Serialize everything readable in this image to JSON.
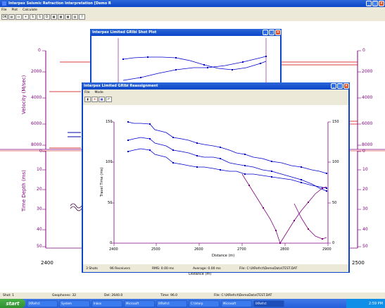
{
  "app": {
    "title": "Interpex Seismic Refraction Interpretation [Demo R",
    "menu": [
      "File",
      "Plot",
      "Calculate"
    ],
    "toolbar": [
      "OK",
      "",
      "",
      "",
      "S",
      "S",
      "D",
      "",
      "",
      "",
      "",
      "?"
    ]
  },
  "main_plot": {
    "left_axis_label": "Velocity (M/sec)",
    "left_axis_ticks": [
      "0",
      "2000",
      "4000",
      "6000",
      "8000"
    ],
    "right_axis_ticks": [
      "0",
      "2000",
      "4000",
      "6000",
      "8000"
    ],
    "depth_axis_label": "Time Depth (ms)",
    "depth_ticks": [
      "0",
      "10",
      "20",
      "30",
      "40",
      "50"
    ],
    "depth_right_ticks": [
      "0",
      "10",
      "20",
      "30",
      "40",
      "50"
    ],
    "bottom_left_label": "2400",
    "bottom_right_label": "2500",
    "bottom_axis_label": "Distance (m)"
  },
  "gribi_window": {
    "title": "Interpex Limited GRIbi Shot Plot"
  },
  "reassign_window": {
    "title": "Interpex Limited GRIbi Reassignment",
    "menu": [
      "File",
      "Mode"
    ],
    "toolbar": [
      "",
      "",
      "",
      ""
    ],
    "y_label": "Travel Time (ms)",
    "x_label": "Distance (m)",
    "y_ticks": [
      "150",
      "100",
      "50",
      "0"
    ],
    "y_right_ticks": [
      "150",
      "100",
      "50",
      "0"
    ],
    "x_ticks": [
      "2400",
      "2500",
      "2600",
      "2700",
      "2800",
      "2900"
    ],
    "status": [
      "3 Shots",
      "96 Receivers",
      "RMS: 0.00 ms",
      "Average: 0.00 ms",
      "File: C:\\IXRefrct\\DemoData\\TEST.DAT"
    ]
  },
  "status_bar": [
    "Shot: 1",
    "Geophones: 32",
    "Del: 2640.0",
    "Time: 96.0",
    "File: C:\\IXRefrct\\DemoData\\TEST.DAT"
  ],
  "taskbar": {
    "start": "start",
    "tasks": [
      "IXRefrct",
      "System",
      "Inbox",
      "Microsoft",
      "IXRefrct",
      "C:\\Interp",
      "Microsoft",
      "IXRefrct"
    ],
    "clock": "2:59 PM"
  }
}
